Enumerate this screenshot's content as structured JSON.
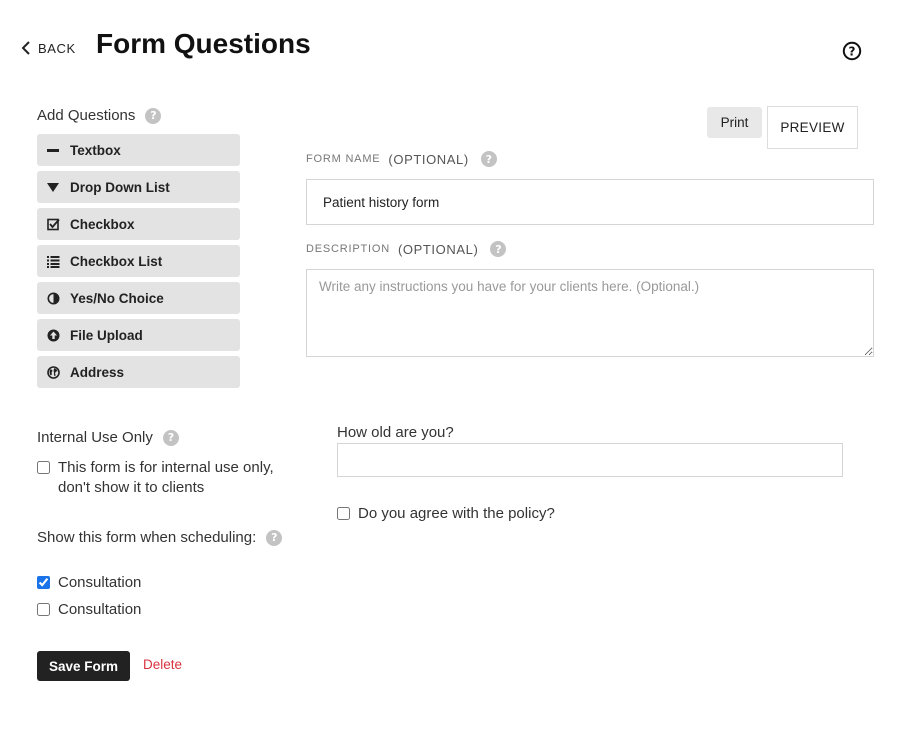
{
  "header": {
    "back_label": "BACK",
    "title": "Form Questions"
  },
  "add_questions": {
    "label": "Add Questions",
    "buttons": [
      {
        "label": "Textbox",
        "icon": "minus-icon"
      },
      {
        "label": "Drop Down List",
        "icon": "triangle-down-icon"
      },
      {
        "label": "Checkbox",
        "icon": "checkbox-icon"
      },
      {
        "label": "Checkbox List",
        "icon": "list-icon"
      },
      {
        "label": "Yes/No Choice",
        "icon": "half-circle-icon"
      },
      {
        "label": "File Upload",
        "icon": "upload-icon"
      },
      {
        "label": "Address",
        "icon": "globe-icon"
      }
    ]
  },
  "internal": {
    "label": "Internal Use Only",
    "checkbox_label_line1": "This form is for internal use only,",
    "checkbox_label_line2": "don't show it to clients",
    "checked": false
  },
  "scheduling": {
    "label": "Show this form when scheduling:",
    "options": [
      {
        "label": "Consultation",
        "checked": true
      },
      {
        "label": "Consultation",
        "checked": false
      }
    ]
  },
  "actions": {
    "save_label": "Save Form",
    "delete_label": "Delete"
  },
  "toolbar": {
    "print_label": "Print",
    "preview_label": "PREVIEW"
  },
  "form_name": {
    "label": "FORM NAME",
    "optional": "(OPTIONAL)",
    "value": "Patient history form"
  },
  "description": {
    "label": "DESCRIPTION",
    "optional": "(OPTIONAL)",
    "placeholder": "Write any instructions you have for your clients here. (Optional.)"
  },
  "questions": {
    "q1": {
      "label": "How old are you?",
      "value": ""
    },
    "q2": {
      "label": "Do you agree with the policy?",
      "checked": false
    }
  },
  "colors": {
    "accent": "#1a73e8",
    "delete": "#d9333f",
    "button_bg": "#e3e3e3",
    "save_bg": "#222222"
  }
}
